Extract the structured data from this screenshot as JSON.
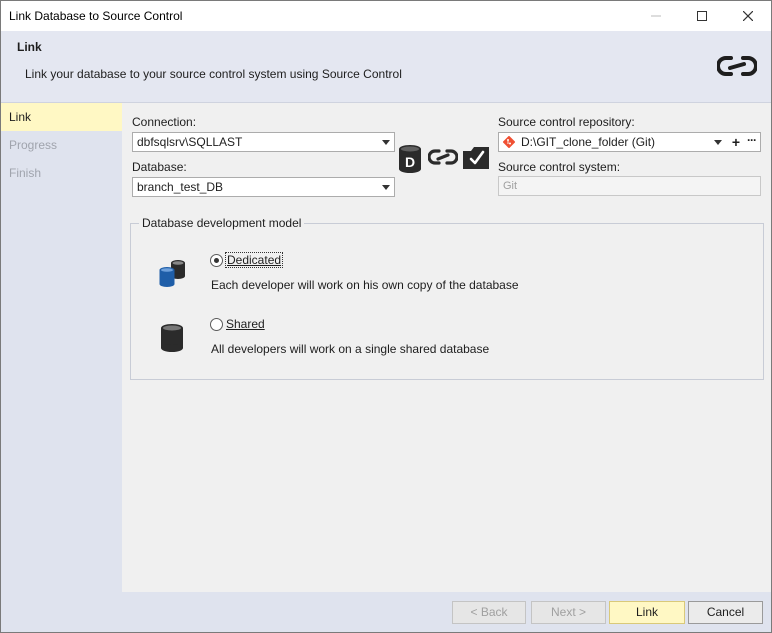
{
  "window": {
    "title": "Link Database to Source Control"
  },
  "header": {
    "title": "Link",
    "description": "Link your database to your source control system using Source Control"
  },
  "nav": {
    "items": [
      {
        "label": "Link",
        "active": true
      },
      {
        "label": "Progress",
        "active": false
      },
      {
        "label": "Finish",
        "active": false
      }
    ]
  },
  "connection": {
    "label_prefix": "Connection:",
    "value": "dbfsqlsrv\\SQLLAST"
  },
  "database": {
    "label": "Database:",
    "value": "branch_test_DB"
  },
  "repository": {
    "label": "Source control repository:",
    "value": "D:\\GIT_clone_folder (Git)"
  },
  "system": {
    "label": "Source control system:",
    "value": "Git"
  },
  "dev_model": {
    "title": "Database development model",
    "dedicated": {
      "label": "Dedicated",
      "description": "Each developer will work on his own copy of the database",
      "checked": true
    },
    "shared": {
      "label": "Shared",
      "description": "All developers will work on a single shared database",
      "checked": false
    }
  },
  "footer": {
    "back_label": "< Back",
    "next_label": "Next >",
    "link_label": "Link",
    "cancel_label": "Cancel"
  },
  "colors": {
    "header_bg": "#e4e7f1",
    "nav_bg": "#dfe3ee",
    "active_highlight": "#fff8c4",
    "db_blue": "#1f5ea8",
    "git_orange": "#f05033"
  }
}
